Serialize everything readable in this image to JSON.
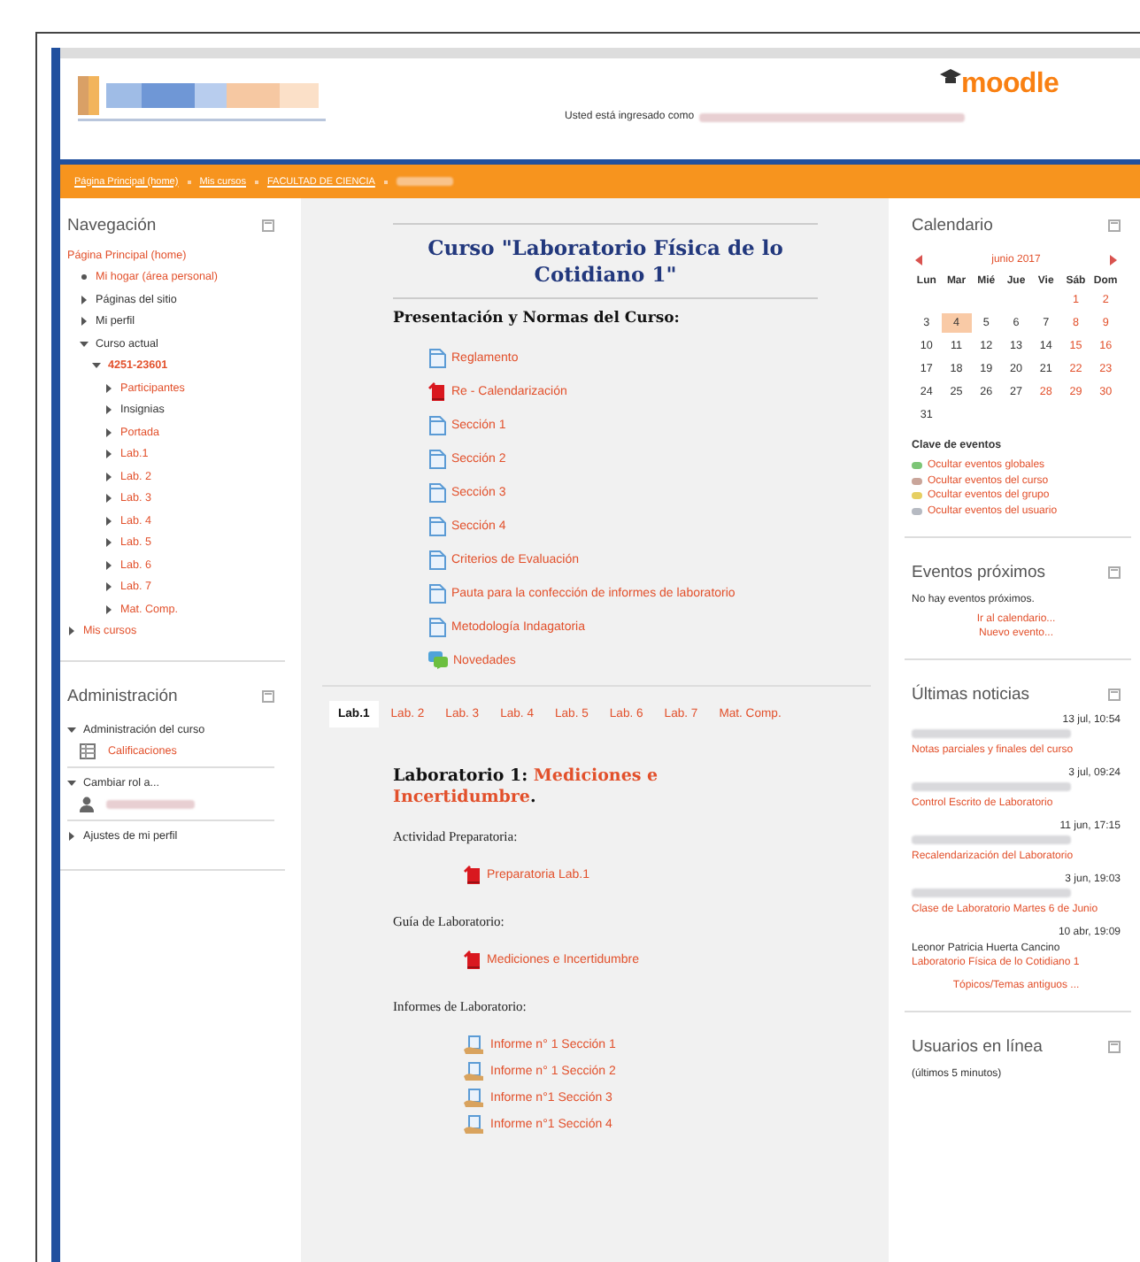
{
  "header": {
    "logo_text": "moodle",
    "logged_in_text": "Usted está ingresado como"
  },
  "breadcrumb": [
    {
      "kind": "link",
      "label": "Página Principal (home)"
    },
    {
      "kind": "link",
      "label": "Mis cursos"
    },
    {
      "kind": "link",
      "label": "FACULTAD DE CIENCIA"
    },
    {
      "kind": "blurred"
    }
  ],
  "navigation": {
    "title": "Navegación",
    "items": [
      {
        "label": "Página Principal (home)",
        "kind": "root",
        "link": true,
        "children": [
          {
            "label": "Mi hogar (área personal)",
            "kind": "leaf",
            "link": true
          },
          {
            "label": "Páginas del sitio",
            "kind": "branch",
            "expanded": false,
            "link": false
          },
          {
            "label": "Mi perfil",
            "kind": "branch",
            "expanded": false,
            "link": false
          },
          {
            "label": "Curso actual",
            "kind": "branch",
            "expanded": true,
            "link": false,
            "children": [
              {
                "label": "4251-23601",
                "kind": "branch",
                "expanded": true,
                "link": true,
                "current": true,
                "children": [
                  {
                    "label": "Participantes",
                    "kind": "branch",
                    "expanded": false,
                    "link": true
                  },
                  {
                    "label": "Insignias",
                    "kind": "branch",
                    "expanded": false,
                    "link": false
                  },
                  {
                    "label": "Portada",
                    "kind": "branch",
                    "expanded": false,
                    "link": true
                  },
                  {
                    "label": "Lab.1",
                    "kind": "branch",
                    "expanded": false,
                    "link": true
                  },
                  {
                    "label": "Lab. 2",
                    "kind": "branch",
                    "expanded": false,
                    "link": true
                  },
                  {
                    "label": "Lab. 3",
                    "kind": "branch",
                    "expanded": false,
                    "link": true
                  },
                  {
                    "label": "Lab. 4",
                    "kind": "branch",
                    "expanded": false,
                    "link": true
                  },
                  {
                    "label": "Lab. 5",
                    "kind": "branch",
                    "expanded": false,
                    "link": true
                  },
                  {
                    "label": "Lab. 6",
                    "kind": "branch",
                    "expanded": false,
                    "link": true
                  },
                  {
                    "label": "Lab. 7",
                    "kind": "branch",
                    "expanded": false,
                    "link": true
                  },
                  {
                    "label": "Mat. Comp.",
                    "kind": "branch",
                    "expanded": false,
                    "link": true
                  }
                ]
              }
            ]
          }
        ]
      },
      {
        "label": "Mis cursos",
        "kind": "branch",
        "expanded": false,
        "link": true
      }
    ]
  },
  "administration": {
    "title": "Administración",
    "items": [
      {
        "label": "Administración del curso",
        "kind": "branch",
        "expanded": true,
        "link": false,
        "children": [
          {
            "label": "Calificaciones",
            "kind": "grades",
            "link": true
          }
        ]
      },
      {
        "label": "Cambiar rol a...",
        "kind": "branch",
        "expanded": true,
        "link": false,
        "children": [
          {
            "kind": "user"
          }
        ]
      },
      {
        "label": "Ajustes de mi perfil",
        "kind": "branch",
        "expanded": false,
        "link": false
      }
    ]
  },
  "course_title": "Curso \"Laboratorio Física de lo Cotidiano 1\"",
  "section_heading": "Presentación y Normas del Curso:",
  "resources": [
    {
      "kind": "page",
      "label": "Reglamento"
    },
    {
      "kind": "pdf",
      "label": "Re - Calendarización"
    },
    {
      "kind": "page",
      "label": "Sección 1"
    },
    {
      "kind": "page",
      "label": "Sección 2"
    },
    {
      "kind": "page",
      "label": "Sección 3"
    },
    {
      "kind": "page",
      "label": "Sección 4"
    },
    {
      "kind": "page",
      "label": "Criterios de Evaluación"
    },
    {
      "kind": "page",
      "label": "Pauta para la confección de informes de laboratorio"
    },
    {
      "kind": "page",
      "label": "Metodología Indagatoria"
    },
    {
      "kind": "forum",
      "label": "Novedades"
    }
  ],
  "tabs": [
    {
      "label": "Lab.1",
      "selected": true
    },
    {
      "label": "Lab. 2",
      "selected": false
    },
    {
      "label": "Lab. 3",
      "selected": false
    },
    {
      "label": "Lab. 4",
      "selected": false
    },
    {
      "label": "Lab. 5",
      "selected": false
    },
    {
      "label": "Lab. 6",
      "selected": false
    },
    {
      "label": "Lab. 7",
      "selected": false
    },
    {
      "label": "Mat. Comp.",
      "selected": false
    }
  ],
  "lab": {
    "title": "Laboratorio 1: ",
    "title_link": "Mediciones e Incertidumbre",
    "title_end": ".",
    "groups": [
      {
        "label": "Actividad Preparatoria:",
        "resources": [
          {
            "kind": "pdf",
            "label": "Preparatoria Lab.1"
          }
        ]
      },
      {
        "label": "Guía de Laboratorio:",
        "resources": [
          {
            "kind": "pdf",
            "label": "Mediciones e Incertidumbre"
          }
        ]
      },
      {
        "label": "Informes de Laboratorio:",
        "resources": [
          {
            "kind": "assign",
            "label": "Informe n° 1 Sección 1"
          },
          {
            "kind": "assign",
            "label": "Informe n° 1 Sección 2"
          },
          {
            "kind": "assign",
            "label": "Informe n°1 Sección 3"
          },
          {
            "kind": "assign",
            "label": "Informe n°1 Sección 4"
          }
        ]
      }
    ]
  },
  "calendar": {
    "title": "Calendario",
    "month": "junio 2017",
    "weekdays": [
      "Lun",
      "Mar",
      "Mié",
      "Jue",
      "Vie",
      "Sáb",
      "Dom"
    ],
    "weeks": [
      {
        "kind": "first",
        "days": [
          {
            "day": "1",
            "weekend": true
          },
          {
            "day": "2",
            "weekend": true
          }
        ]
      },
      {
        "days": [
          {
            "day": "3"
          },
          {
            "day": "4",
            "today": true
          },
          {
            "day": "5"
          },
          {
            "day": "6"
          },
          {
            "day": "7"
          },
          {
            "day": "8",
            "weekend": true
          },
          {
            "day": "9",
            "weekend": true
          }
        ]
      },
      {
        "days": [
          {
            "day": "10"
          },
          {
            "day": "11"
          },
          {
            "day": "12"
          },
          {
            "day": "13"
          },
          {
            "day": "14"
          },
          {
            "day": "15",
            "weekend": true
          },
          {
            "day": "16",
            "weekend": true
          }
        ]
      },
      {
        "days": [
          {
            "day": "17"
          },
          {
            "day": "18"
          },
          {
            "day": "19"
          },
          {
            "day": "20"
          },
          {
            "day": "21"
          },
          {
            "day": "22",
            "weekend": true
          },
          {
            "day": "23",
            "weekend": true
          }
        ]
      },
      {
        "days": [
          {
            "day": "24"
          },
          {
            "day": "25"
          },
          {
            "day": "26"
          },
          {
            "day": "27"
          },
          {
            "day": "28",
            "event": true
          },
          {
            "day": "29",
            "weekend": true
          },
          {
            "day": "30",
            "weekend": true
          }
        ]
      },
      {
        "kind": "last",
        "days": [
          {
            "day": "31"
          }
        ]
      }
    ],
    "legend_title": "Clave de eventos",
    "legend": [
      {
        "label": "Ocultar eventos globales",
        "color": "#7cc576"
      },
      {
        "label": "Ocultar eventos del curso",
        "color": "#c9a59a"
      },
      {
        "label": "Ocultar eventos del grupo",
        "color": "#e6cf62"
      },
      {
        "label": "Ocultar eventos del usuario",
        "color": "#b6bac2"
      }
    ]
  },
  "upcoming": {
    "title": "Eventos próximos",
    "text": "No hay eventos próximos.",
    "links": [
      "Ir al calendario...",
      "Nuevo evento..."
    ]
  },
  "news": {
    "title": "Últimas noticias",
    "items": [
      {
        "date": "13 jul, 10:54",
        "author_blurred": true,
        "title": "Notas parciales y finales del curso"
      },
      {
        "date": "3 jul, 09:24",
        "author_blurred": true,
        "title": "Control Escrito de Laboratorio"
      },
      {
        "date": "11 jun, 17:15",
        "author_blurred": true,
        "title": "Recalendarización del Laboratorio"
      },
      {
        "date": "3 jun, 19:03",
        "author_blurred": true,
        "title": "Clase de Laboratorio Martes 6 de Junio"
      },
      {
        "date": "10 abr, 19:09",
        "author": "Leonor Patricia Huerta Cancino",
        "title": "Laboratorio Física de lo Cotidiano 1"
      }
    ],
    "more": "Tópicos/Temas antiguos ..."
  },
  "online": {
    "title": "Usuarios en línea",
    "text": "(últimos 5 minutos)"
  }
}
